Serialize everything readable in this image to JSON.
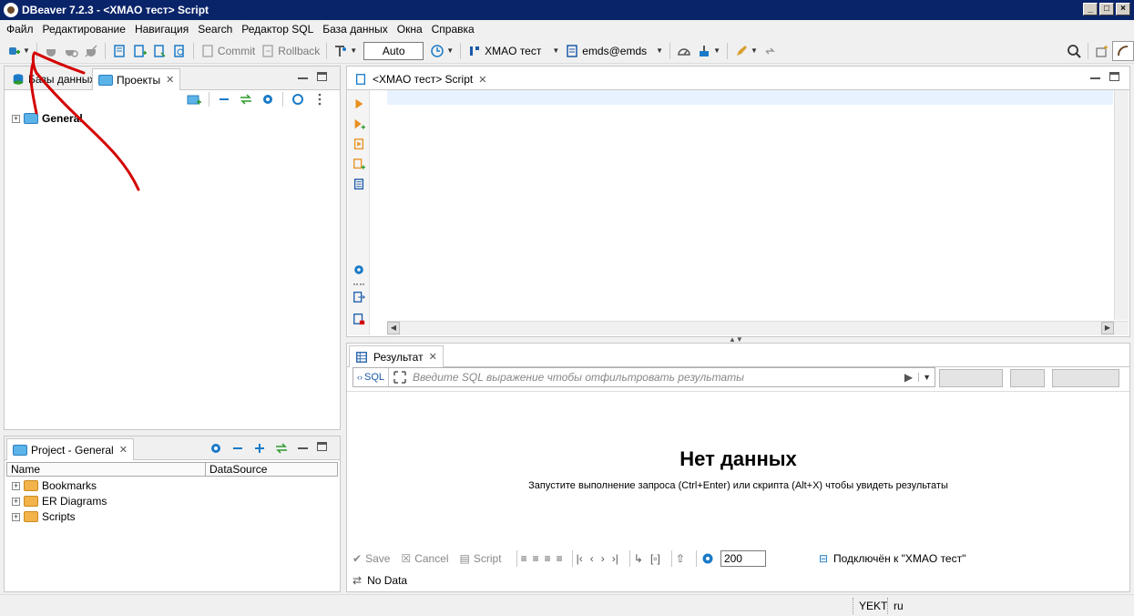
{
  "window": {
    "title": "DBeaver 7.2.3 - <XMAO тест> Script"
  },
  "menu": [
    "Файл",
    "Редактирование",
    "Навигация",
    "Search",
    "Редактор SQL",
    "База данных",
    "Окна",
    "Справка"
  ],
  "toolbar": {
    "commit_label": "Commit",
    "rollback_label": "Rollback",
    "transaction_mode": "Auto",
    "connection": "XMAO тест",
    "schema": "emds@emds"
  },
  "left_panel": {
    "tabs": [
      {
        "label": "Базы данных"
      },
      {
        "label": "Проекты"
      }
    ],
    "tree": [
      {
        "label": "General"
      }
    ]
  },
  "project_panel": {
    "tab_label": "Project - General",
    "columns": [
      "Name",
      "DataSource"
    ],
    "rows": [
      {
        "label": "Bookmarks"
      },
      {
        "label": "ER Diagrams"
      },
      {
        "label": "Scripts"
      }
    ]
  },
  "editor": {
    "tab_label": "<XMAO тест> Script"
  },
  "results": {
    "tab_label": "Результат",
    "sql_label": "SQL",
    "filter_placeholder": "Введите SQL выражение чтобы отфильтровать результаты",
    "empty_title": "Нет данных",
    "empty_subtitle": "Запустите выполнение запроса (Ctrl+Enter) или скрипта (Alt+X) чтобы увидеть результаты",
    "save_label": "Save",
    "cancel_label": "Cancel",
    "script_label": "Script",
    "fetch_limit": "200",
    "connection_status": "Подключён к \"XMAO тест\"",
    "no_data_label": "No Data"
  },
  "statusbar": {
    "timezone": "YEKT",
    "locale": "ru"
  },
  "colors": {
    "titlebar": "#0a246a",
    "accent_blue": "#1a5aa8",
    "annotation_red": "#d40000"
  }
}
